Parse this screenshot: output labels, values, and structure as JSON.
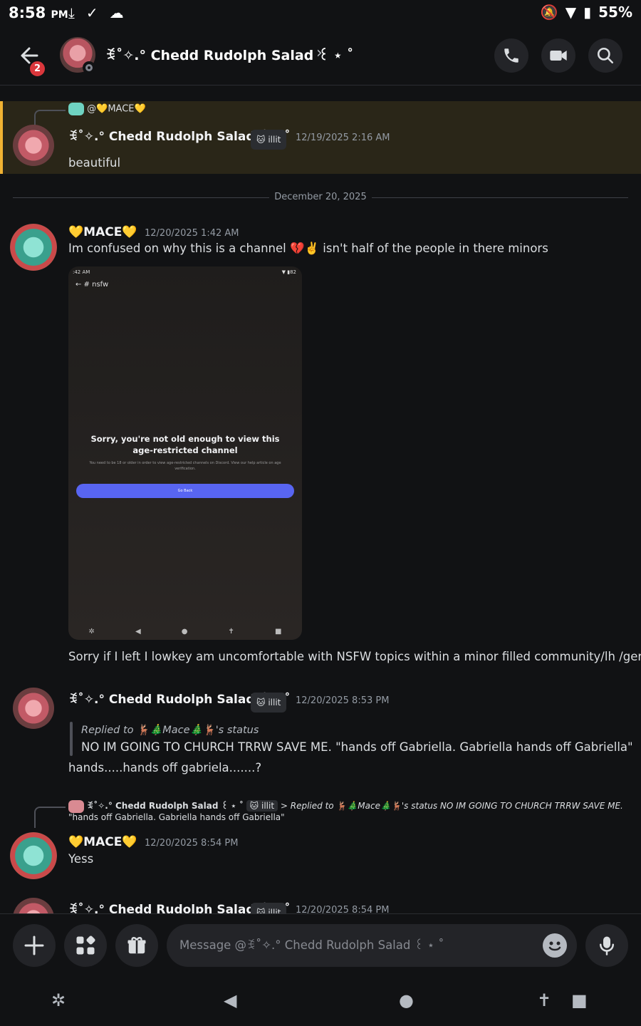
{
  "status_bar": {
    "time": "8:58",
    "ampm": "PM",
    "battery": "55%"
  },
  "header": {
    "unread_badge": "2",
    "title": "ꉂ˚✧.° Chedd Rudolph Salad ꒰ ⋆ ˚"
  },
  "messages": {
    "m1": {
      "reply_to": "@💛MACE💛",
      "author": "ꉂ˚✧.° Chedd Rudolph Salad ꒰ ⋆ ˚",
      "tag": "illit",
      "timestamp": "12/19/2025 2:16 AM",
      "content": "beautiful"
    },
    "divider": "December 20, 2025",
    "m2": {
      "author": "💛MACE💛",
      "timestamp": "12/20/2025 1:42 AM",
      "content": "Im confused on why this is a channel 💔✌️ isn't half of the people in there minors",
      "embed": {
        "time": ":42 AM",
        "battery": "82",
        "channel": "nsfw",
        "title_line1": "Sorry, you're not old enough to view this",
        "title_line2": "age-restricted channel",
        "subtitle": "You need to be 18 or older in order to view age-restricted channels on Discord. View our help article on age verification.",
        "button": "Go Back"
      },
      "followup": "Sorry if I left I lowkey am uncomfortable with NSFW topics within a minor filled community/lh /gen! ^^"
    },
    "m3": {
      "author": "ꉂ˚✧.° Chedd Rudolph Salad ꒰ ⋆ ˚",
      "tag": "illit",
      "timestamp": "12/20/2025 8:53 PM",
      "quote_prefix": "Replied to ",
      "quote_name": "🦌🎄Mace🎄🦌",
      "quote_suffix": "'s status",
      "quote_text": "NO IM GOING TO CHURCH TRRW SAVE ME. \"hands off Gabriella. Gabriella hands off Gabriella\"",
      "content": "hands.....hands off gabriela.......?"
    },
    "m4": {
      "reply_author": "ꉂ˚✧.° Chedd Rudolph Salad ꒰ ⋆ ˚",
      "reply_tag": "illit",
      "reply_preview_1": "> Replied to 🦌🎄Mace🎄🦌's status   NO IM GOING TO CHURCH TRRW SAVE ME.",
      "reply_preview_2": "\"hands off Gabriella. Gabriella hands off Gabriella\"",
      "author": "💛MACE💛",
      "timestamp": "12/20/2025 8:54 PM",
      "content": "Yess"
    },
    "m5": {
      "author": "ꉂ˚✧.° Chedd Rudolph Salad ꒰ ⋆ ˚",
      "tag": "illit",
      "timestamp": "12/20/2025 8:54 PM"
    }
  },
  "composer": {
    "placeholder": "Message @ꉂ˚✧.° Chedd Rudolph Salad ꒰ ⋆ ˚"
  },
  "colors": {
    "accent": "#5865f2",
    "highlight": "#f0b232",
    "badge": "#da373c"
  }
}
